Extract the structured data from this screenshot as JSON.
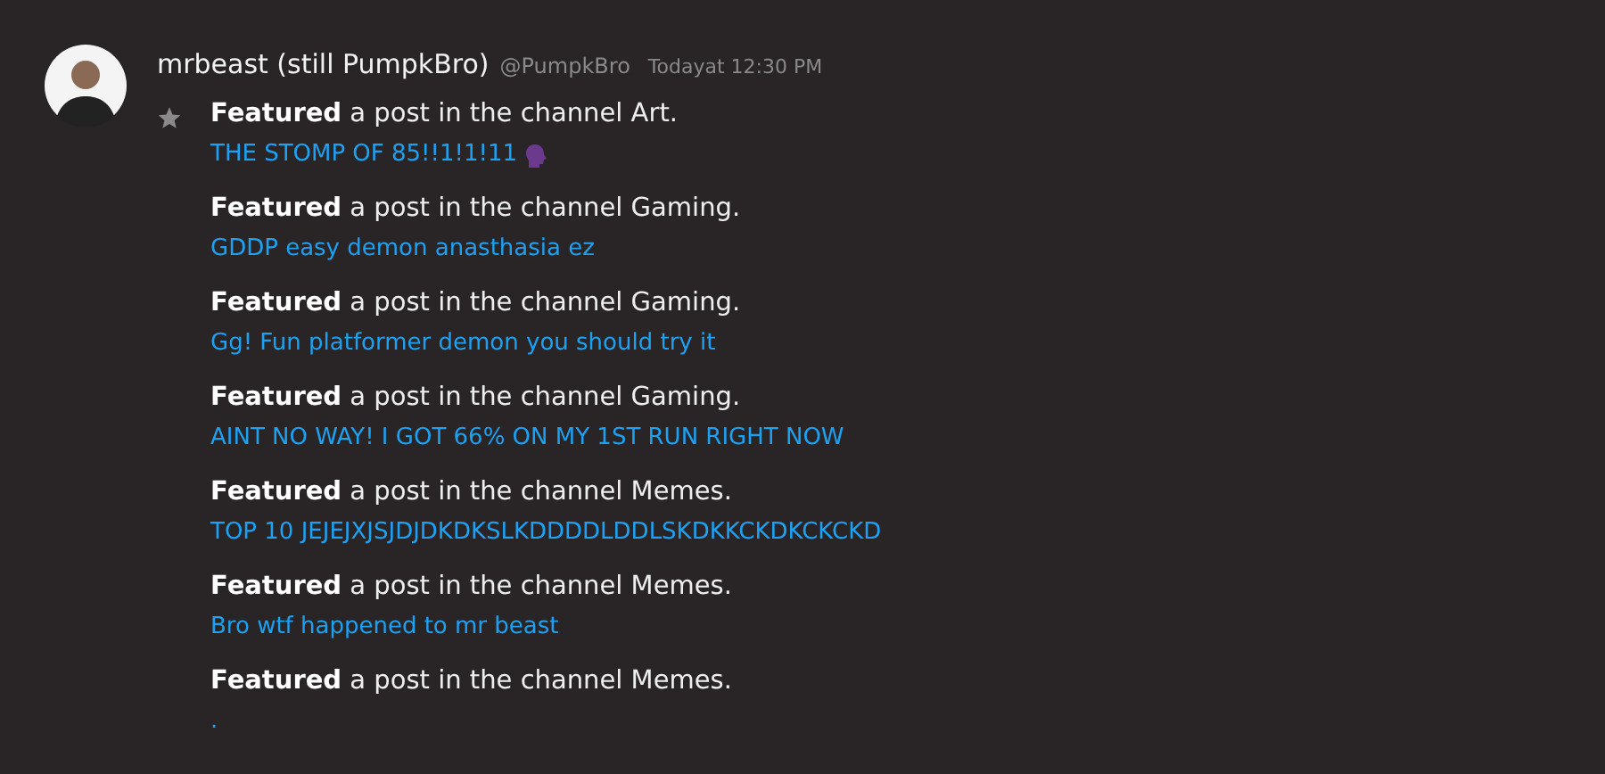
{
  "message": {
    "author": "mrbeast (still PumpkBro)",
    "handle": "@PumpkBro",
    "timestamp": "Todayat 12:30 PM",
    "features": [
      {
        "action": "**Featured** a post in the channel Art.",
        "link": "THE STOMP OF 85!!1!1!11",
        "kind": "speaking"
      },
      {
        "action": "**Featured** a post in the channel Gaming.",
        "link": "GDDP easy demon anasthasia ez",
        "kind": "plain"
      },
      {
        "action": "**Featured** a post in the channel Gaming.",
        "link": "Gg! Fun platformer demon you should try it",
        "kind": "plain"
      },
      {
        "action": "**Featured** a post in the channel Gaming.",
        "link": "AINT NO WAY! I GOT 66% ON MY 1ST RUN RIGHT NOW",
        "kind": "plain"
      },
      {
        "action": "**Featured** a post in the channel Memes.",
        "link": "TOP 10 JEJEJXJSJDJDKDKSLKDDDDLDDLSKDKKCKDKCKCKD",
        "kind": "plain"
      },
      {
        "action": "**Featured** a post in the channel Memes.",
        "link": "Bro wtf happened to mr beast",
        "kind": "plain"
      },
      {
        "action": "**Featured** a post in the channel Memes.",
        "link": ".",
        "kind": "plain"
      }
    ]
  }
}
